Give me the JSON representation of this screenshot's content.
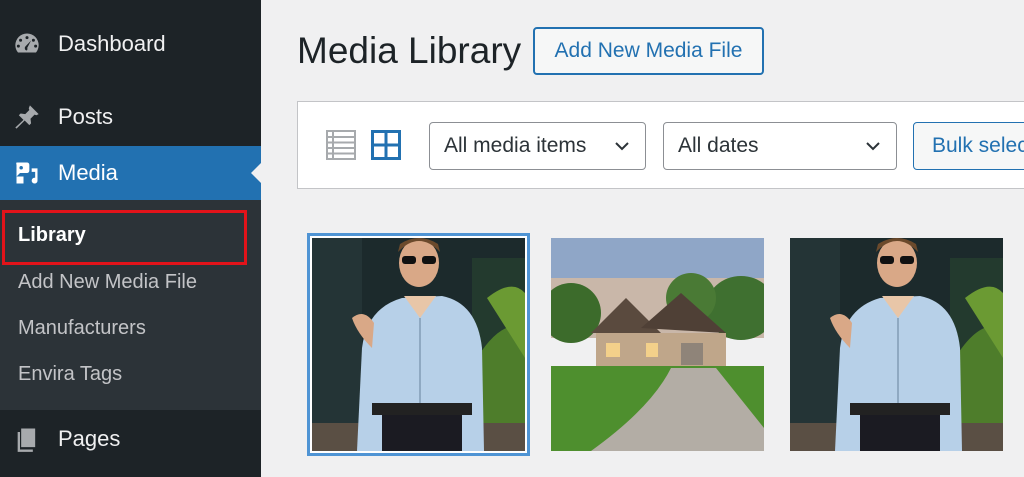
{
  "sidebar": {
    "items": [
      {
        "label": "Dashboard",
        "icon": "dashboard-icon"
      },
      {
        "label": "Posts",
        "icon": "pushpin-icon"
      },
      {
        "label": "Media",
        "icon": "media-icon"
      },
      {
        "label": "Pages",
        "icon": "pages-icon"
      }
    ],
    "submenu": {
      "library": "Library",
      "add_new": "Add New Media File",
      "manufacturers": "Manufacturers",
      "envira_tags": "Envira Tags"
    }
  },
  "header": {
    "title": "Media Library",
    "add_new_label": "Add New Media File"
  },
  "toolbar": {
    "type_filter": "All media items",
    "date_filter": "All dates",
    "bulk_select_label": "Bulk select",
    "views": [
      "list-view-icon",
      "grid-view-icon"
    ]
  },
  "media_items": [
    {
      "name": "man-in-light-blue-shirt",
      "selected": true
    },
    {
      "name": "stone-house-with-driveway",
      "selected": false
    },
    {
      "name": "man-in-light-blue-shirt",
      "selected": false
    }
  ],
  "colors": {
    "sidebar_bg": "#1d2327",
    "submenu_bg": "#2c3338",
    "accent": "#2271b1",
    "highlight": "#e2131a",
    "page_bg": "#f0f0f1"
  }
}
